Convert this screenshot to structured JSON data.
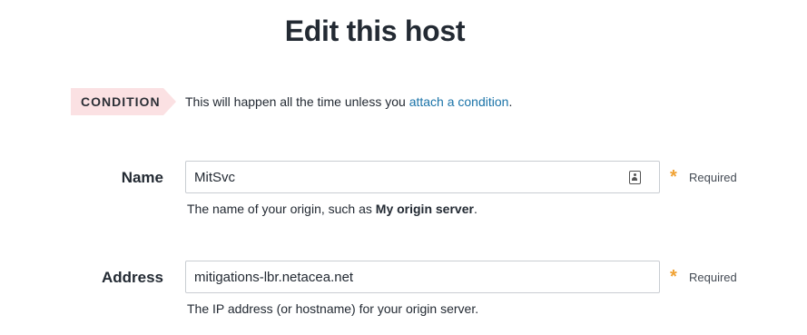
{
  "page": {
    "title": "Edit this host"
  },
  "condition": {
    "badge_label": "CONDITION",
    "text_before": "This will happen all the time unless you ",
    "link_text": "attach a condition",
    "text_after": "."
  },
  "fields": {
    "name": {
      "label": "Name",
      "value": "MitSvc",
      "required_label": "Required",
      "help_before": "The name of your origin, such as ",
      "help_bold": "My origin server",
      "help_after": "."
    },
    "address": {
      "label": "Address",
      "value": "mitigations-lbr.netacea.net",
      "required_label": "Required",
      "help": "The IP address (or hostname) for your origin server."
    }
  },
  "colors": {
    "accent_link": "#1a73a8",
    "required_star": "#f0a234",
    "condition_badge": "#fbe1e3"
  }
}
